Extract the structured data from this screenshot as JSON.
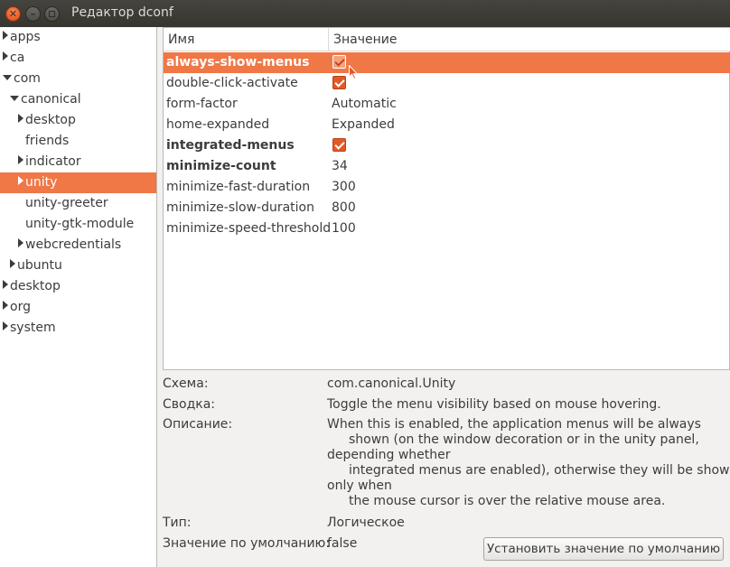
{
  "window": {
    "title": "Редактор dconf"
  },
  "tree": {
    "items": [
      {
        "label": "apps",
        "expander": "right",
        "depth": 0,
        "selected": false
      },
      {
        "label": "ca",
        "expander": "right",
        "depth": 0,
        "selected": false
      },
      {
        "label": "com",
        "expander": "down",
        "depth": 0,
        "selected": false
      },
      {
        "label": "canonical",
        "expander": "down",
        "depth": 1,
        "selected": false
      },
      {
        "label": "desktop",
        "expander": "right",
        "depth": 2,
        "selected": false
      },
      {
        "label": "friends",
        "expander": "none",
        "depth": 2,
        "selected": false
      },
      {
        "label": "indicator",
        "expander": "right",
        "depth": 2,
        "selected": false
      },
      {
        "label": "unity",
        "expander": "right",
        "depth": 2,
        "selected": true
      },
      {
        "label": "unity-greeter",
        "expander": "none",
        "depth": 2,
        "selected": false
      },
      {
        "label": "unity-gtk-module",
        "expander": "none",
        "depth": 2,
        "selected": false
      },
      {
        "label": "webcredentials",
        "expander": "right",
        "depth": 2,
        "selected": false
      },
      {
        "label": "ubuntu",
        "expander": "right",
        "depth": 1,
        "selected": false
      },
      {
        "label": "desktop",
        "expander": "right",
        "depth": 0,
        "selected": false
      },
      {
        "label": "org",
        "expander": "right",
        "depth": 0,
        "selected": false
      },
      {
        "label": "system",
        "expander": "right",
        "depth": 0,
        "selected": false
      }
    ]
  },
  "keys": {
    "header": {
      "name": "Имя",
      "value": "Значение"
    },
    "rows": [
      {
        "name": "always-show-menus",
        "value": "",
        "type": "check",
        "bold": true,
        "selected": true
      },
      {
        "name": "double-click-activate",
        "value": "",
        "type": "check",
        "bold": false,
        "selected": false
      },
      {
        "name": "form-factor",
        "value": "Automatic",
        "type": "text",
        "bold": false,
        "selected": false
      },
      {
        "name": "home-expanded",
        "value": "Expanded",
        "type": "text",
        "bold": false,
        "selected": false
      },
      {
        "name": "integrated-menus",
        "value": "",
        "type": "check",
        "bold": true,
        "selected": false
      },
      {
        "name": "minimize-count",
        "value": "34",
        "type": "text",
        "bold": true,
        "selected": false
      },
      {
        "name": "minimize-fast-duration",
        "value": "300",
        "type": "text",
        "bold": false,
        "selected": false
      },
      {
        "name": "minimize-slow-duration",
        "value": "800",
        "type": "text",
        "bold": false,
        "selected": false
      },
      {
        "name": "minimize-speed-threshold",
        "value": "100",
        "type": "text",
        "bold": false,
        "selected": false
      }
    ]
  },
  "info": {
    "schema_label": "Схема:",
    "schema_value": "com.canonical.Unity",
    "summary_label": "Сводка:",
    "summary_value": "Toggle the menu visibility based on mouse hovering.",
    "description_label": "Описание:",
    "description_lines": [
      "When this is enabled, the application menus will be always",
      "shown (on the window decoration or in the unity panel,",
      "depending whether",
      "integrated menus are enabled), otherwise they will be shown",
      "only when",
      "the mouse cursor is over the relative mouse area."
    ],
    "type_label": "Тип:",
    "type_value": "Логическое",
    "default_label": "Значение по умолчанию:",
    "default_value": "false",
    "reset_button": "Установить значение по умолчанию"
  },
  "colors": {
    "accent": "#f07746",
    "titlebar": "#3c3b37",
    "close": "#dd4814"
  }
}
